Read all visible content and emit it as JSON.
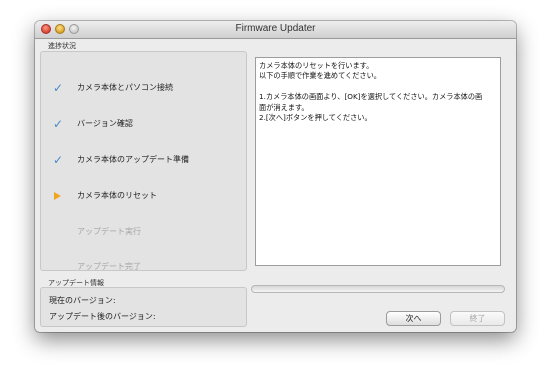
{
  "window": {
    "title": "Firmware Updater"
  },
  "progress_section": {
    "label": "進捗状況",
    "steps": [
      {
        "label": "カメラ本体とパソコン接続",
        "state": "done",
        "icon": "checkmark-icon"
      },
      {
        "label": "バージョン確認",
        "state": "done",
        "icon": "checkmark-icon"
      },
      {
        "label": "カメラ本体のアップデート準備",
        "state": "done",
        "icon": "checkmark-icon"
      },
      {
        "label": "カメラ本体のリセット",
        "state": "current",
        "icon": "current-step-arrow-icon"
      },
      {
        "label": "アップデート実行",
        "state": "pending",
        "icon": ""
      },
      {
        "label": "アップデート完了",
        "state": "pending",
        "icon": ""
      }
    ],
    "check_glyph": "✓"
  },
  "instructions": {
    "lines": [
      "カメラ本体のリセットを行います。",
      "以下の手順で作業を進めてください。",
      "",
      "1.カメラ本体の画面より、[OK]を選択してください。カメラ本体の画",
      "面が消えます。",
      "2.[次へ]ボタンを押してください。"
    ]
  },
  "update_info": {
    "label": "アップデート情報",
    "current_version_label": "現在のバージョン:",
    "updated_version_label": "アップデート後のバージョン:"
  },
  "buttons": {
    "next_label": "次へ",
    "finish_label": "終了"
  },
  "colors": {
    "check": "#4a88c8",
    "current_arrow": "#f0a623",
    "pending_text": "#a6a6a6"
  }
}
